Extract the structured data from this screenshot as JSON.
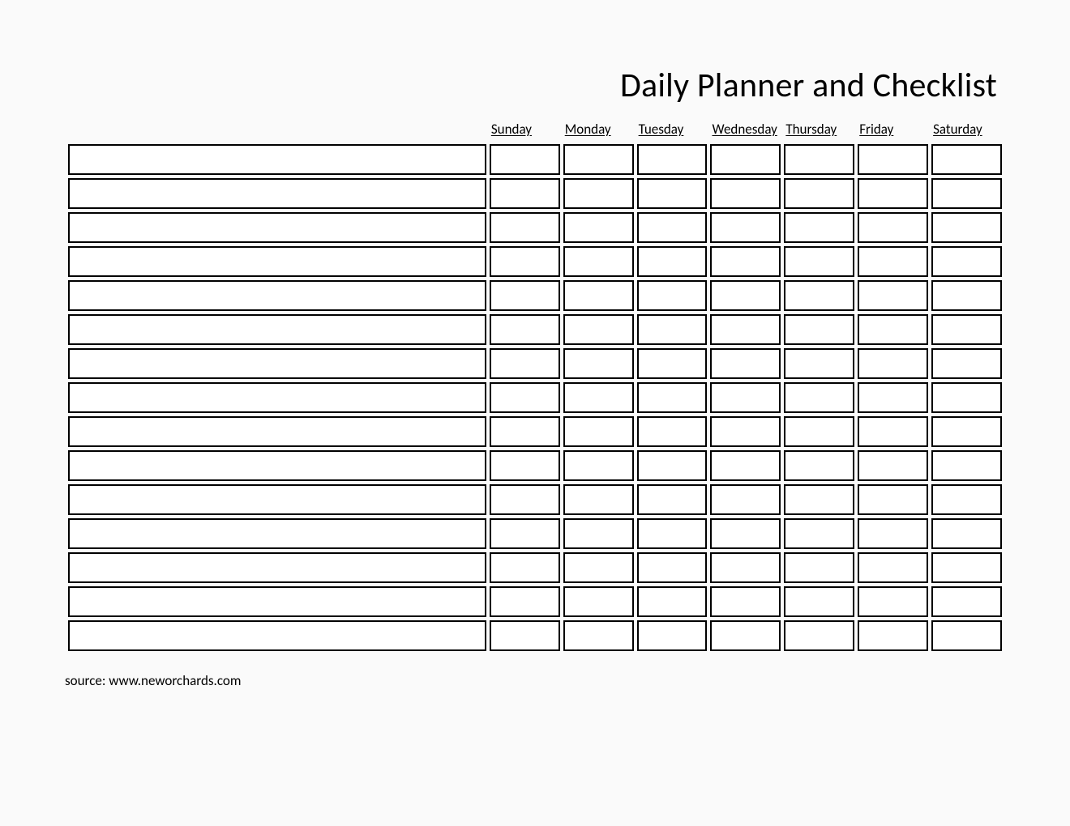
{
  "title": "Daily Planner and Checklist",
  "headers": {
    "task": "",
    "days": [
      "Sunday",
      "Monday",
      "Tuesday",
      "Wednesday",
      "Thursday",
      "Friday",
      "Saturday"
    ]
  },
  "rows": [
    {
      "task": "",
      "sunday": "",
      "monday": "",
      "tuesday": "",
      "wednesday": "",
      "thursday": "",
      "friday": "",
      "saturday": ""
    },
    {
      "task": "",
      "sunday": "",
      "monday": "",
      "tuesday": "",
      "wednesday": "",
      "thursday": "",
      "friday": "",
      "saturday": ""
    },
    {
      "task": "",
      "sunday": "",
      "monday": "",
      "tuesday": "",
      "wednesday": "",
      "thursday": "",
      "friday": "",
      "saturday": ""
    },
    {
      "task": "",
      "sunday": "",
      "monday": "",
      "tuesday": "",
      "wednesday": "",
      "thursday": "",
      "friday": "",
      "saturday": ""
    },
    {
      "task": "",
      "sunday": "",
      "monday": "",
      "tuesday": "",
      "wednesday": "",
      "thursday": "",
      "friday": "",
      "saturday": ""
    },
    {
      "task": "",
      "sunday": "",
      "monday": "",
      "tuesday": "",
      "wednesday": "",
      "thursday": "",
      "friday": "",
      "saturday": ""
    },
    {
      "task": "",
      "sunday": "",
      "monday": "",
      "tuesday": "",
      "wednesday": "",
      "thursday": "",
      "friday": "",
      "saturday": ""
    },
    {
      "task": "",
      "sunday": "",
      "monday": "",
      "tuesday": "",
      "wednesday": "",
      "thursday": "",
      "friday": "",
      "saturday": ""
    },
    {
      "task": "",
      "sunday": "",
      "monday": "",
      "tuesday": "",
      "wednesday": "",
      "thursday": "",
      "friday": "",
      "saturday": ""
    },
    {
      "task": "",
      "sunday": "",
      "monday": "",
      "tuesday": "",
      "wednesday": "",
      "thursday": "",
      "friday": "",
      "saturday": ""
    },
    {
      "task": "",
      "sunday": "",
      "monday": "",
      "tuesday": "",
      "wednesday": "",
      "thursday": "",
      "friday": "",
      "saturday": ""
    },
    {
      "task": "",
      "sunday": "",
      "monday": "",
      "tuesday": "",
      "wednesday": "",
      "thursday": "",
      "friday": "",
      "saturday": ""
    },
    {
      "task": "",
      "sunday": "",
      "monday": "",
      "tuesday": "",
      "wednesday": "",
      "thursday": "",
      "friday": "",
      "saturday": ""
    },
    {
      "task": "",
      "sunday": "",
      "monday": "",
      "tuesday": "",
      "wednesday": "",
      "thursday": "",
      "friday": "",
      "saturday": ""
    },
    {
      "task": "",
      "sunday": "",
      "monday": "",
      "tuesday": "",
      "wednesday": "",
      "thursday": "",
      "friday": "",
      "saturday": ""
    }
  ],
  "source": "source: www.neworchards.com"
}
